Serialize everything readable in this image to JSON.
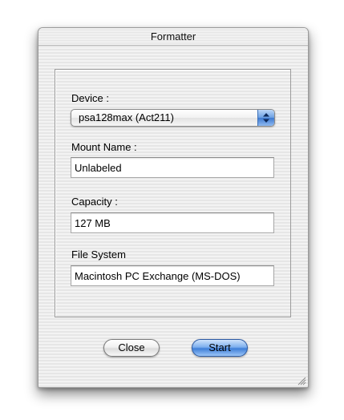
{
  "window": {
    "title": "Formatter"
  },
  "form": {
    "device": {
      "label": "Device :",
      "value": "psa128max (Act211)"
    },
    "mount_name": {
      "label": "Mount Name :",
      "value": "Unlabeled"
    },
    "capacity": {
      "label": "Capacity :",
      "value": "127 MB"
    },
    "file_system": {
      "label": "File System",
      "value": "Macintosh PC Exchange (MS-DOS)"
    }
  },
  "buttons": {
    "close_label": "Close",
    "start_label": "Start"
  },
  "icons": {
    "popup_arrows": "up-down-arrows-icon",
    "resize": "resize-grip-icon"
  },
  "colors": {
    "accent_blue": "#3f7fd8"
  }
}
